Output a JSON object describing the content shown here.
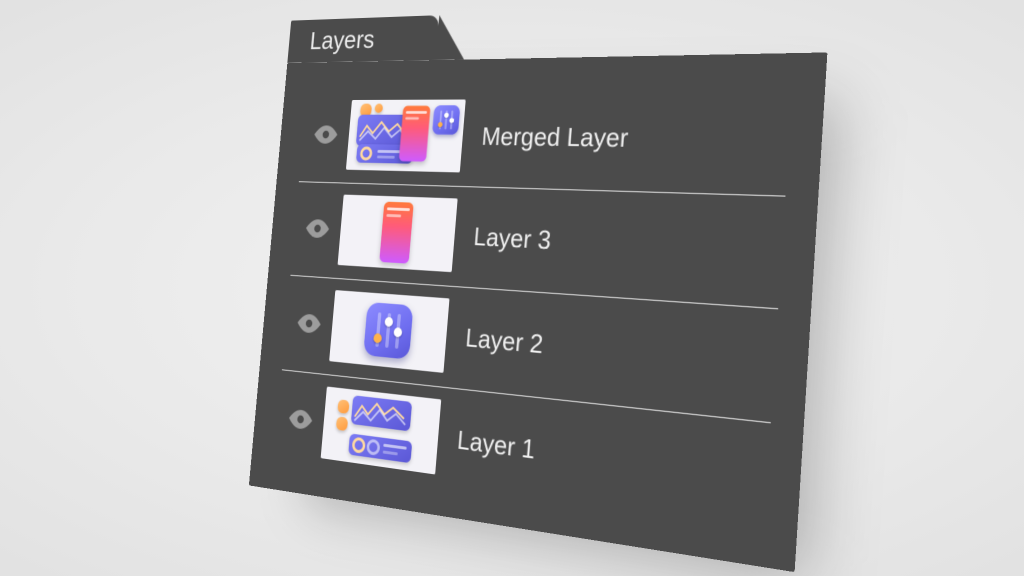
{
  "panel": {
    "title": "Layers",
    "layers": [
      {
        "name": "Merged Layer",
        "visible": true,
        "thumb": "merged"
      },
      {
        "name": "Layer 3",
        "visible": true,
        "thumb": "phone"
      },
      {
        "name": "Layer 2",
        "visible": true,
        "thumb": "sliders"
      },
      {
        "name": "Layer 1",
        "visible": true,
        "thumb": "charts"
      }
    ]
  }
}
